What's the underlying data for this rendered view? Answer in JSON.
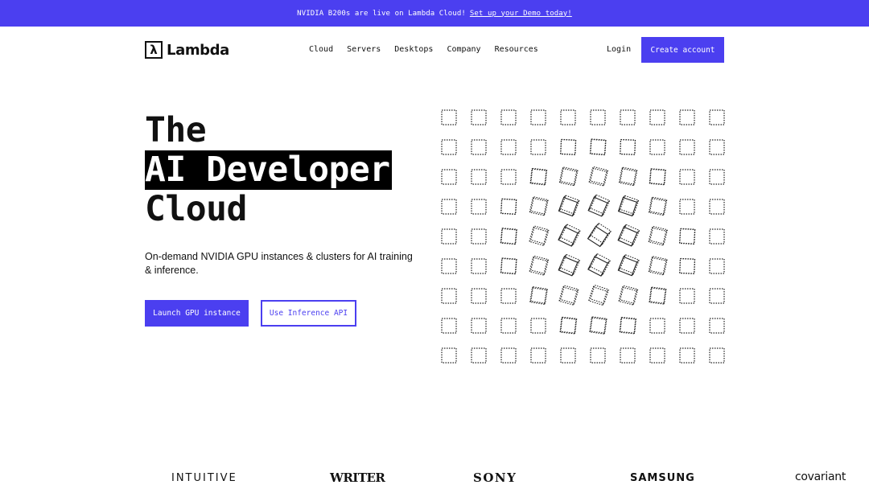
{
  "banner": {
    "text": "NVIDIA B200s are live on Lambda Cloud!",
    "link": "Set up your Demo today!"
  },
  "header": {
    "logo_text": "Lambda",
    "logo_mark": "λ",
    "nav": [
      "Cloud",
      "Servers",
      "Desktops",
      "Company",
      "Resources"
    ],
    "login": "Login",
    "create_account": "Create account"
  },
  "hero": {
    "line1": "The",
    "line2": "AI Developer",
    "line3": "Cloud",
    "subtitle": "On-demand NVIDIA GPU instances & clusters for AI training & inference.",
    "primary_cta": "Launch GPU instance",
    "secondary_cta": "Use Inference API"
  },
  "customers": [
    "INTUITIVE",
    "WRITER",
    "SONY",
    "SAMSUNG",
    "covariant"
  ],
  "colors": {
    "accent": "#4b3ff0",
    "text": "#111111",
    "background": "#ffffff"
  },
  "icons": {
    "logo": "lambda-logo-icon",
    "graphic": "cube-grid-graphic"
  }
}
